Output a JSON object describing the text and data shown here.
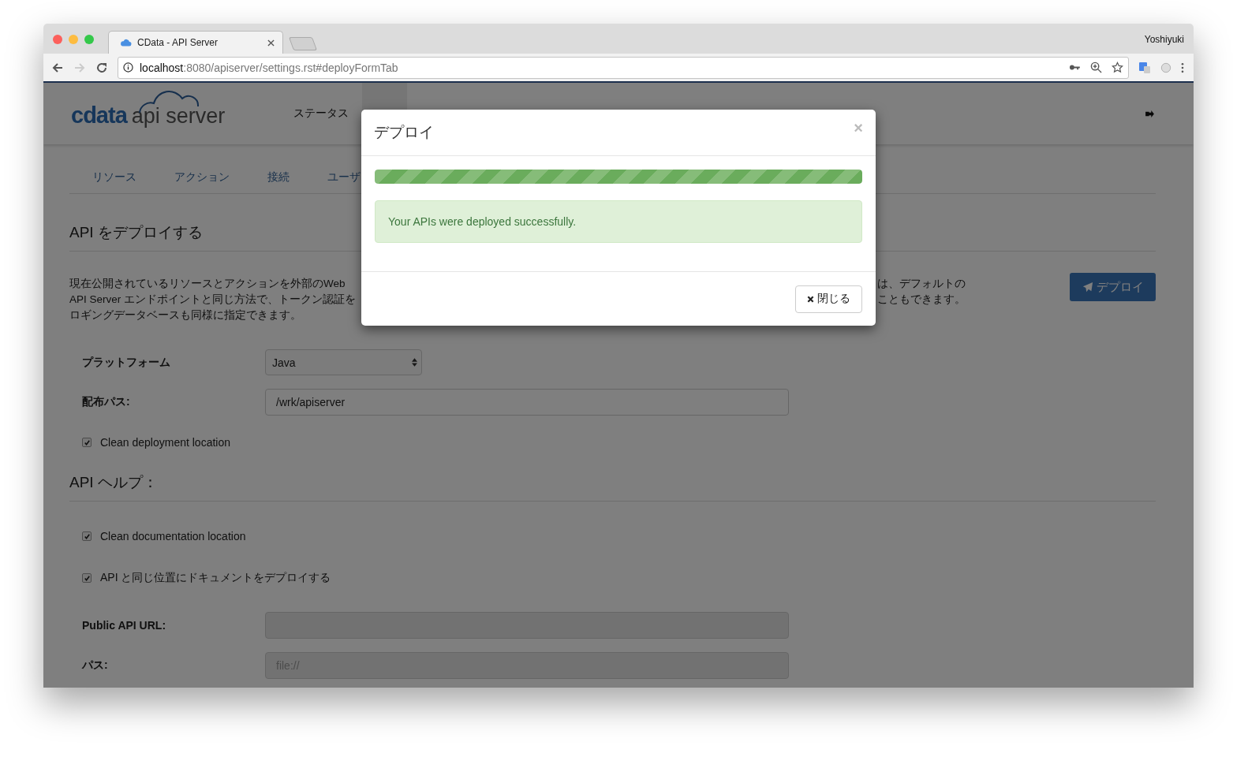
{
  "browser": {
    "tab_title": "CData - API Server",
    "url_host": "localhost",
    "url_rest": ":8080/apiserver/settings.rst#deployFormTab",
    "profile": "Yoshiyuki"
  },
  "header": {
    "logo_brand": "cdata",
    "logo_product": "api server",
    "nav": [
      {
        "label": "ステータス"
      }
    ]
  },
  "tabs": [
    {
      "label": "リソース"
    },
    {
      "label": "アクション"
    },
    {
      "label": "接続"
    },
    {
      "label": "ユーザ"
    }
  ],
  "deploy_section": {
    "title": "API をデプロイする",
    "description_left": [
      "現在公開されているリソースとアクションを外部のWeb",
      "API Server エンドポイントと同じ方法で、トークン認証を",
      "ロギングデータベースも同様に指定できます。"
    ],
    "description_right": [
      "は、デフォルトの",
      "こともできます。"
    ],
    "deploy_button": "デプロイ"
  },
  "form": {
    "platform_label": "プラットフォーム",
    "platform_value": "Java",
    "path_label": "配布パス:",
    "path_value": "/wrk/apiserver",
    "clean_deploy": {
      "label": "Clean deployment location",
      "checked": true
    }
  },
  "help_section": {
    "title": "API ヘルプ：",
    "checkboxes": [
      {
        "label": "Clean documentation location",
        "checked": true
      },
      {
        "label": "API と同じ位置にドキュメントをデプロイする",
        "checked": true
      }
    ],
    "public_url_label": "Public API URL:",
    "public_url": {
      "disabled": true
    },
    "path_label": "パス:",
    "path_placeholder": "file://",
    "path_disabled": true
  },
  "modal": {
    "title": "デプロイ",
    "close": "×",
    "progress": {
      "level": 1
    },
    "message": "Your APIs were deployed successfully.",
    "close_button": "閉じる"
  }
}
